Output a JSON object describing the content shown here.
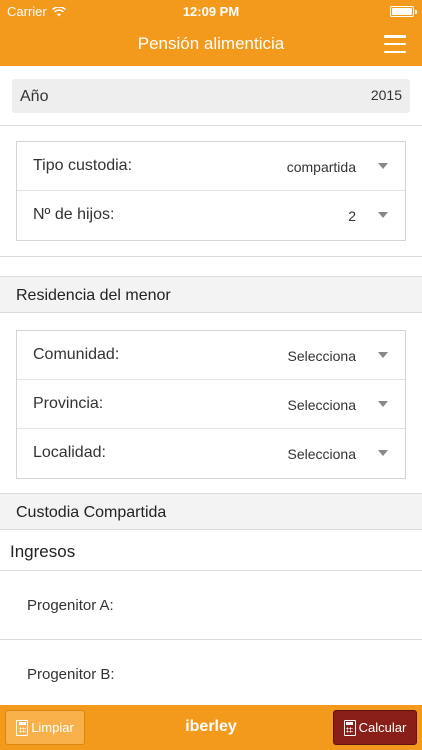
{
  "status_bar": {
    "carrier": "Carrier",
    "time": "12:09 PM"
  },
  "navbar": {
    "title": "Pensión alimenticia"
  },
  "year": {
    "label": "Año",
    "value": "2015"
  },
  "custody_card": {
    "rows": [
      {
        "label": "Tipo custodia:",
        "value": "compartida"
      },
      {
        "label": "Nº de hijos:",
        "value": "2"
      }
    ]
  },
  "residence_section": {
    "title": "Residencia del menor"
  },
  "residence_card": {
    "rows": [
      {
        "label": "Comunidad:",
        "value": "Selecciona"
      },
      {
        "label": "Provincia:",
        "value": "Selecciona"
      },
      {
        "label": "Localidad:",
        "value": "Selecciona"
      }
    ]
  },
  "shared_custody_section": {
    "title": "Custodia Compartida"
  },
  "income": {
    "heading": "Ingresos",
    "fields": [
      {
        "label": "Progenitor A:",
        "value": ""
      },
      {
        "label": "Progenitor B:",
        "value": ""
      }
    ]
  },
  "bottom_bar": {
    "clear_label": "Limpiar",
    "brand": "iberley",
    "calculate_label": "Calcular"
  },
  "colors": {
    "accent": "#f39a1c",
    "calculate_button": "#8a1f1a",
    "section_bg": "#f3f3f3"
  }
}
